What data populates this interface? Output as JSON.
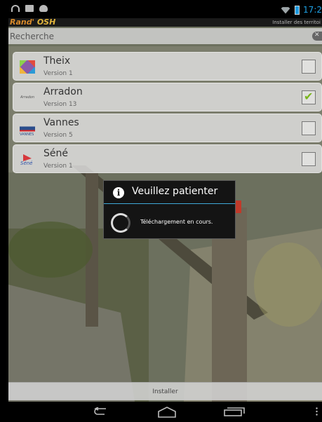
{
  "status_bar": {
    "time": "17:2",
    "left_icons": [
      "wifi-icon",
      "image-icon",
      "cat-icon"
    ],
    "right_icons": [
      "wifi-icon",
      "battery-icon"
    ]
  },
  "action_bar": {
    "logo": "Rand' OSH",
    "logo_first": "Rand'",
    "logo_second": "OSH",
    "title": "Installer des territoi"
  },
  "search": {
    "placeholder": "Recherche",
    "value": ""
  },
  "territories": [
    {
      "name": "Theix",
      "version": "Version 1",
      "checked": false,
      "icon": "theix-logo-icon"
    },
    {
      "name": "Arradon",
      "version": "Version 13",
      "checked": true,
      "icon": "arradon-logo-icon",
      "icon_text": "Arradon"
    },
    {
      "name": "Vannes",
      "version": "Version 5",
      "checked": false,
      "icon": "vannes-logo-icon",
      "icon_text": "VANNES"
    },
    {
      "name": "Séné",
      "version": "Version 1",
      "checked": false,
      "icon": "sene-logo-icon",
      "icon_text": "Séné"
    }
  ],
  "dialog": {
    "title": "Veuillez patienter",
    "message": "Téléchargement en cours."
  },
  "install_button": {
    "label": "Installer"
  },
  "colors": {
    "accent": "#3fa9d8",
    "time": "#1ea2e6",
    "check": "#7ab51d"
  }
}
